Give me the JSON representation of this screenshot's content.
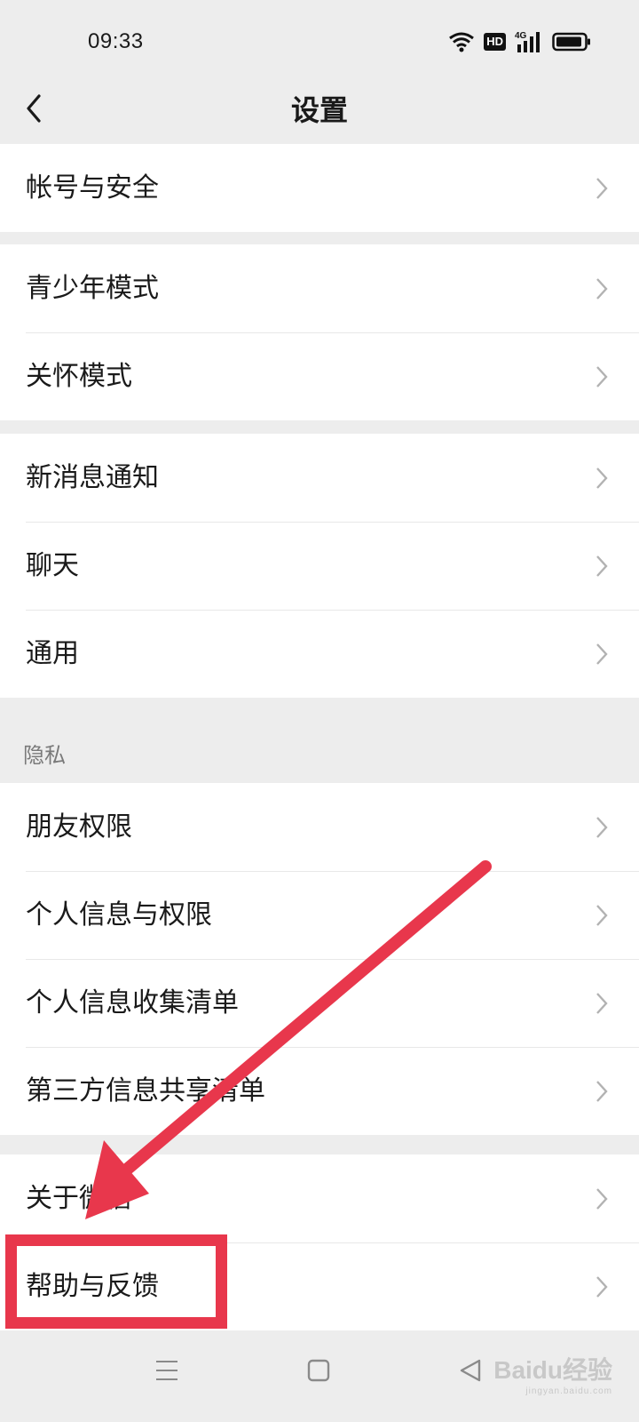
{
  "status_bar": {
    "time": "09:33",
    "hd_badge": "HD",
    "network": "4G",
    "icons": [
      "wifi-icon",
      "hd-badge",
      "signal-icon",
      "battery-icon"
    ]
  },
  "nav": {
    "title": "设置",
    "back_icon": "chevron-left-icon"
  },
  "groups": {
    "account": [
      "帐号与安全"
    ],
    "modes": [
      "青少年模式",
      "关怀模式"
    ],
    "general": [
      "新消息通知",
      "聊天",
      "通用"
    ],
    "privacy_header": "隐私",
    "privacy": [
      "朋友权限",
      "个人信息与权限",
      "个人信息收集清单",
      "第三方信息共享清单"
    ],
    "about": [
      "关于微信",
      "帮助与反馈"
    ]
  },
  "bottom_nav": {
    "icons": [
      "menu-icon",
      "home-square-icon",
      "back-triangle-icon"
    ]
  },
  "watermark": {
    "text": "Baidu经验",
    "subtext": "jingyan.baidu.com"
  },
  "annotation": {
    "color": "#e8374c",
    "highlighted_item": "帮助与反馈"
  }
}
